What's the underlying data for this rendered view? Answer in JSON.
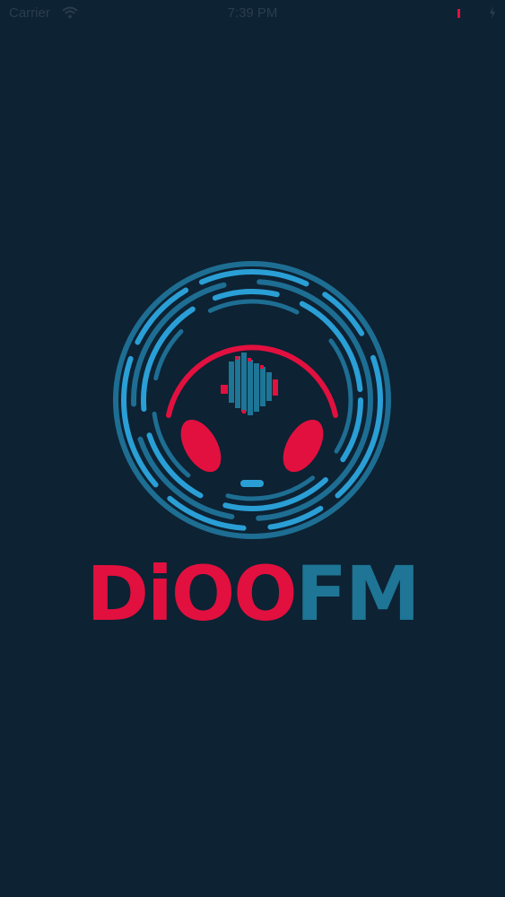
{
  "status_bar": {
    "carrier": "Carrier",
    "time": "7:39 PM",
    "wifi_icon": "wifi-icon",
    "battery_icon": "battery-icon",
    "charge_icon": "charging-icon"
  },
  "logo": {
    "name_part1": "DiOO",
    "name_part2": "FM",
    "icon": "headphones-waveform-icon"
  },
  "colors": {
    "background": "#0d2233",
    "brand_red": "#e2103f",
    "brand_blue": "#1e7595",
    "ring_light_blue": "#2a9fd6"
  }
}
